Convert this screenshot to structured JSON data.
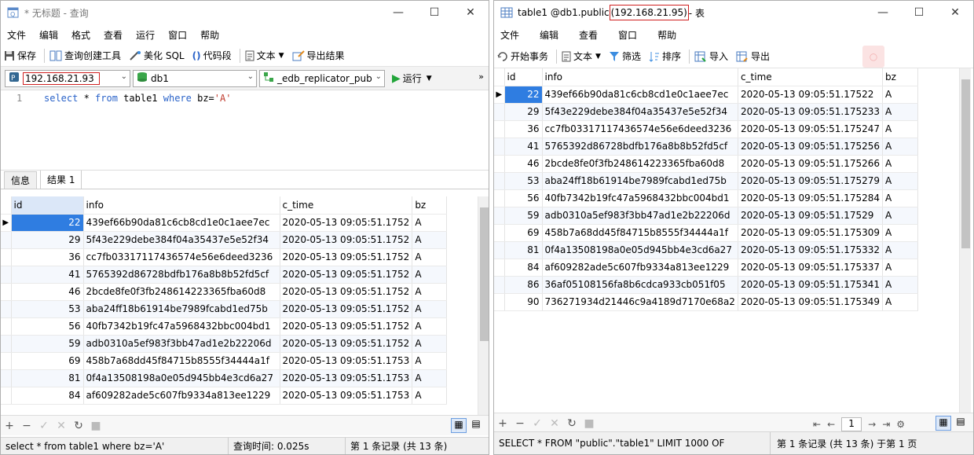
{
  "w1": {
    "title": "* 无标题 - 查询",
    "menus": [
      "文件",
      "编辑",
      "格式",
      "查看",
      "运行",
      "窗口",
      "帮助"
    ],
    "toolbar": {
      "save": "保存",
      "query_builder": "查询创建工具",
      "beautify": "美化 SQL",
      "snippet": "代码段",
      "text": "文本",
      "export": "导出结果"
    },
    "conn": {
      "server": "192.168.21.93",
      "db": "db1",
      "schema": "_edb_replicator_pub",
      "run": "运行"
    },
    "editor": {
      "line": "1",
      "kw1": "select",
      "star": " * ",
      "kw2": "from",
      "tbl": " table1 ",
      "kw3": "where",
      "cond": " bz=",
      "val": "'A'"
    },
    "tabs": [
      "信息",
      "结果 1"
    ],
    "columns": [
      "id",
      "info",
      "c_time",
      "bz"
    ],
    "rows": [
      [
        "22",
        "439ef66b90da81c6cb8cd1e0c1aee7ec",
        "2020-05-13 09:05:51.1752",
        "A"
      ],
      [
        "29",
        "5f43e229debe384f04a35437e5e52f34",
        "2020-05-13 09:05:51.1752",
        "A"
      ],
      [
        "36",
        "cc7fb03317117436574e56e6deed3236",
        "2020-05-13 09:05:51.1752",
        "A"
      ],
      [
        "41",
        "5765392d86728bdfb176a8b8b52fd5cf",
        "2020-05-13 09:05:51.1752",
        "A"
      ],
      [
        "46",
        "2bcde8fe0f3fb248614223365fba60d8",
        "2020-05-13 09:05:51.1752",
        "A"
      ],
      [
        "53",
        "aba24ff18b61914be7989fcabd1ed75b",
        "2020-05-13 09:05:51.1752",
        "A"
      ],
      [
        "56",
        "40fb7342b19fc47a5968432bbc004bd1",
        "2020-05-13 09:05:51.1752",
        "A"
      ],
      [
        "59",
        "adb0310a5ef983f3bb47ad1e2b22206d",
        "2020-05-13 09:05:51.1752",
        "A"
      ],
      [
        "69",
        "458b7a68dd45f84715b8555f34444a1f",
        "2020-05-13 09:05:51.1753",
        "A"
      ],
      [
        "81",
        "0f4a13508198a0e05d945bb4e3cd6a27",
        "2020-05-13 09:05:51.1753",
        "A"
      ],
      [
        "84",
        "af609282ade5c607fb9334a813ee1229",
        "2020-05-13 09:05:51.1753",
        "A"
      ]
    ],
    "status": {
      "sql": "select * from table1 where bz='A'",
      "time": "查询时间: 0.025s",
      "records": "第 1 条记录 (共 13 条)"
    }
  },
  "w2": {
    "title_pre": "table1 @db1.public ",
    "title_ip": "(192.168.21.95)",
    "title_post": " - 表",
    "menus": [
      "文件",
      "编辑",
      "查看",
      "窗口",
      "帮助"
    ],
    "toolbar": {
      "begin": "开始事务",
      "text": "文本",
      "filter": "筛选",
      "sort": "排序",
      "import": "导入",
      "export": "导出"
    },
    "columns": [
      "id",
      "info",
      "c_time",
      "bz"
    ],
    "rows": [
      [
        "22",
        "439ef66b90da81c6cb8cd1e0c1aee7ec",
        "2020-05-13 09:05:51.17522",
        "A"
      ],
      [
        "29",
        "5f43e229debe384f04a35437e5e52f34",
        "2020-05-13 09:05:51.175233",
        "A"
      ],
      [
        "36",
        "cc7fb03317117436574e56e6deed3236",
        "2020-05-13 09:05:51.175247",
        "A"
      ],
      [
        "41",
        "5765392d86728bdfb176a8b8b52fd5cf",
        "2020-05-13 09:05:51.175256",
        "A"
      ],
      [
        "46",
        "2bcde8fe0f3fb248614223365fba60d8",
        "2020-05-13 09:05:51.175266",
        "A"
      ],
      [
        "53",
        "aba24ff18b61914be7989fcabd1ed75b",
        "2020-05-13 09:05:51.175279",
        "A"
      ],
      [
        "56",
        "40fb7342b19fc47a5968432bbc004bd1",
        "2020-05-13 09:05:51.175284",
        "A"
      ],
      [
        "59",
        "adb0310a5ef983f3bb47ad1e2b22206d",
        "2020-05-13 09:05:51.17529",
        "A"
      ],
      [
        "69",
        "458b7a68dd45f84715b8555f34444a1f",
        "2020-05-13 09:05:51.175309",
        "A"
      ],
      [
        "81",
        "0f4a13508198a0e05d945bb4e3cd6a27",
        "2020-05-13 09:05:51.175332",
        "A"
      ],
      [
        "84",
        "af609282ade5c607fb9334a813ee1229",
        "2020-05-13 09:05:51.175337",
        "A"
      ],
      [
        "86",
        "36af05108156fa8b6cdca933cb051f05",
        "2020-05-13 09:05:51.175341",
        "A"
      ],
      [
        "90",
        "736271934d21446c9a4189d7170e68a2",
        "2020-05-13 09:05:51.175349",
        "A"
      ]
    ],
    "page": "1",
    "status": {
      "sql": "SELECT * FROM \"public\".\"table1\" LIMIT 1000 OF",
      "records": "第 1 条记录 (共 13 条) 于第 1 页"
    }
  },
  "colors": {
    "selected": "#2f7de1",
    "ip_box": "#d02020",
    "keyword": "#2a63c9",
    "run": "#22a53a"
  }
}
